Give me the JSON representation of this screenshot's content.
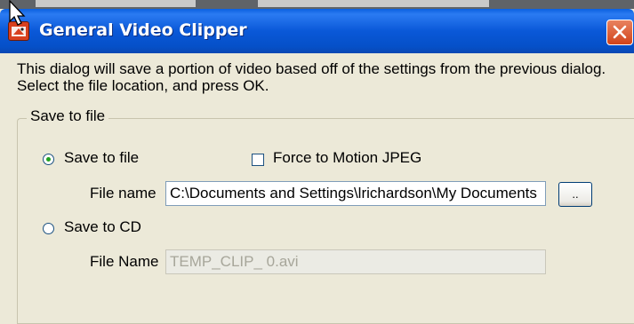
{
  "window": {
    "title": "General Video Clipper"
  },
  "dialog": {
    "description": "This dialog will save a portion of video based off of the settings from the previous dialog.  Select the file location, and press OK.",
    "group_title": "Save to file",
    "save_to_file": {
      "label": "Save to file",
      "selected": true
    },
    "force_mjpeg": {
      "label": "Force to Motion JPEG",
      "checked": false
    },
    "file_name": {
      "label": "File name",
      "value": "C:\\Documents and Settings\\lrichardson\\My Documents"
    },
    "browse_label": "..",
    "save_to_cd": {
      "label": "Save to CD",
      "selected": false
    },
    "cd_file_name": {
      "label": "File Name",
      "value": "TEMP_CLIP_ 0.avi",
      "disabled": true
    }
  },
  "colors": {
    "titlebar": "#0a58d8",
    "close_button": "#d2431a",
    "dialog_bg": "#ece9d8",
    "radio_dot": "#21a121"
  }
}
